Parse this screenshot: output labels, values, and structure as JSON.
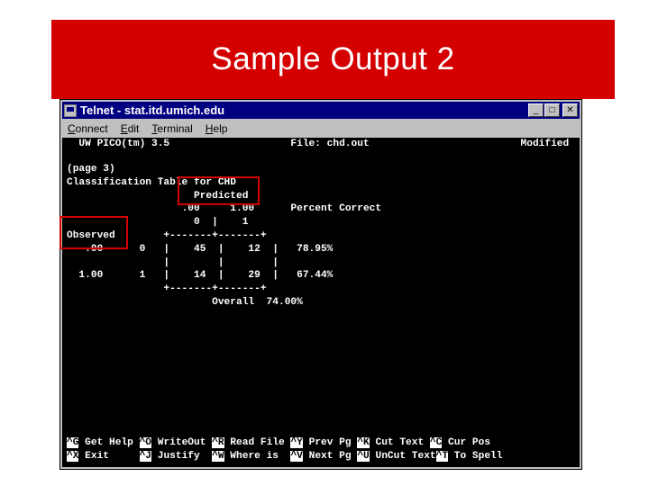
{
  "slide": {
    "title": "Sample Output 2",
    "banner_color": "#d40000",
    "title_color": "#ffffff"
  },
  "window": {
    "titlebar": {
      "icon": "telnet-icon",
      "title": "Telnet - stat.itd.umich.edu",
      "buttons": [
        {
          "name": "minimize-button",
          "glyph": "_"
        },
        {
          "name": "maximize-button",
          "glyph": "□"
        },
        {
          "name": "close-button",
          "glyph": "✕"
        }
      ]
    },
    "menubar": [
      {
        "label": "Connect",
        "accel": "C"
      },
      {
        "label": "Edit",
        "accel": "E"
      },
      {
        "label": "Terminal",
        "accel": "T"
      },
      {
        "label": "Help",
        "accel": "H"
      }
    ]
  },
  "terminal": {
    "status_line": "  UW PICO(tm) 3.5                    File: chd.out                         Modified",
    "body": [
      "(page 3)",
      "Classification Table for CHD",
      "                          Predicted",
      "                       .00      1.00        Percent Correct",
      "                        0  |     1",
      "Observed     +-------+-------+",
      "    .00      0   |     45  |     12  |    78.95%",
      "                 |         |         |",
      "   1.00      1   |     14  |     29  |    67.44%",
      "                 +-------+-------+",
      "                           Overall  74.00%"
    ],
    "body_lines": [
      "(page 3)",
      "Classification Table for CHD",
      "                     Predicted",
      "                   .00     1.00      Percent Correct",
      "                     0  |    1",
      "Observed        +-------+-------+",
      "   .00      0   |    45  |    12  |   78.95%",
      "                |        |        |",
      "  1.00      1   |    14  |    29  |   67.44%",
      "                +-------+-------+",
      "                        Overall  74.00%"
    ],
    "footer_lines": [
      [
        {
          "key": "^G",
          "label": " Get Help "
        },
        {
          "key": "^O",
          "label": " WriteOut "
        },
        {
          "key": "^R",
          "label": " Read File "
        },
        {
          "key": "^Y",
          "label": " Prev Pg "
        },
        {
          "key": "^K",
          "label": " Cut Text "
        },
        {
          "key": "^C",
          "label": " Cur Pos"
        }
      ],
      [
        {
          "key": "^X",
          "label": " Exit     "
        },
        {
          "key": "^J",
          "label": " Justify  "
        },
        {
          "key": "^W",
          "label": " Where is  "
        },
        {
          "key": "^V",
          "label": " Next Pg "
        },
        {
          "key": "^U",
          "label": " UnCut Text"
        },
        {
          "key": "^T",
          "label": " To Spell"
        }
      ]
    ]
  },
  "annotations": [
    {
      "name": "predicted-highlight",
      "target": "Predicted"
    },
    {
      "name": "observed-highlight",
      "target": "Observed"
    }
  ],
  "chart_data": {
    "type": "table",
    "title": "Classification Table for CHD",
    "row_header": "Observed",
    "column_header": "Predicted",
    "categories": [
      ".00",
      "1.00"
    ],
    "column_codes": [
      "0",
      "1"
    ],
    "row_codes": [
      "0",
      "1"
    ],
    "cells": [
      [
        45,
        12
      ],
      [
        14,
        29
      ]
    ],
    "percent_correct_label": "Percent Correct",
    "percent_correct": [
      "78.95%",
      "67.44%"
    ],
    "overall_label": "Overall",
    "overall": "74.00%"
  }
}
